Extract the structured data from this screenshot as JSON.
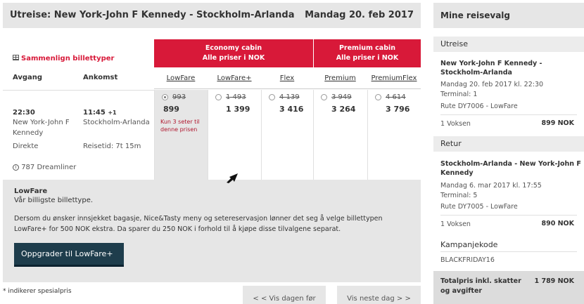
{
  "left": {
    "title": "Utreise:  New York-John F Kennedy - Stockholm-Arlanda",
    "date": "Mandag 20. feb 2017",
    "compare_link": "Sammenlign billettyper",
    "col_departure": "Avgang",
    "col_arrival": "Ankomst",
    "cabins": [
      {
        "name": "Economy cabin",
        "note": "Alle priser i NOK"
      },
      {
        "name": "Premium cabin",
        "note": "Alle priser i NOK"
      }
    ],
    "fares": [
      {
        "name": "LowFare",
        "old": "993",
        "price": "899",
        "selected": true,
        "seats": "Kun 3 seter til denne prisen"
      },
      {
        "name": "LowFare+",
        "old": "1 493",
        "price": "1 399",
        "selected": false
      },
      {
        "name": "Flex",
        "old": "4 139",
        "price": "3 416",
        "selected": false
      },
      {
        "name": "Premium",
        "old": "3 949",
        "price": "3 264",
        "selected": false
      },
      {
        "name": "PremiumFlex",
        "old": "4 614",
        "price": "3 796",
        "selected": false
      }
    ],
    "flight": {
      "dep_time": "22:30",
      "dep_place": "New York-John F Kennedy",
      "arr_time": "11:45",
      "arr_offset": "+1",
      "arr_place": "Stockholm-Arlanda",
      "stops": "Direkte",
      "duration": "Reisetid: 7t 15m",
      "aircraft": "787 Dreamliner"
    },
    "info": {
      "title": "LowFare",
      "subtitle": "Vår billigste billettype.",
      "description": "Dersom du ønsker innsjekket bagasje, Nice&Tasty meny og setereservasjon lønner det seg å velge billettypen LowFare+ for 500 NOK ekstra. Da sparer du 250 NOK i forhold til å kjøpe disse tilvalgene separat.",
      "upgrade_button": "Oppgrader til LowFare+"
    },
    "footnote": "* indikerer spesialpris",
    "prev_day": "< < Vis dagen før",
    "next_day": "Vis neste dag > >"
  },
  "right": {
    "title": "Mine reisevalg",
    "outbound": {
      "label": "Utreise",
      "route": "New York-John F Kennedy - Stockholm-Arlanda",
      "when": "Mandag 20. feb 2017 kl. 22:30",
      "terminal": "Terminal: 1",
      "rute": "Rute DY7006 - LowFare",
      "pax": "1 Voksen",
      "amount": "899 NOK"
    },
    "return": {
      "label": "Retur",
      "route": "Stockholm-Arlanda - New York-John F Kennedy",
      "when": "Mandag 6. mar 2017 kl. 17:55",
      "terminal": "Terminal: 5",
      "rute": "Rute DY7005 - LowFare",
      "pax": "1 Voksen",
      "amount": "890 NOK"
    },
    "campaign_label": "Kampanjekode",
    "campaign_code": "BLACKFRIDAY16",
    "total_label": "Totalpris inkl. skatter og avgifter",
    "total_amount": "1 789 NOK"
  },
  "colors": {
    "accent": "#d81939",
    "button": "#1e3d4c",
    "panel": "#e6e6e6"
  }
}
